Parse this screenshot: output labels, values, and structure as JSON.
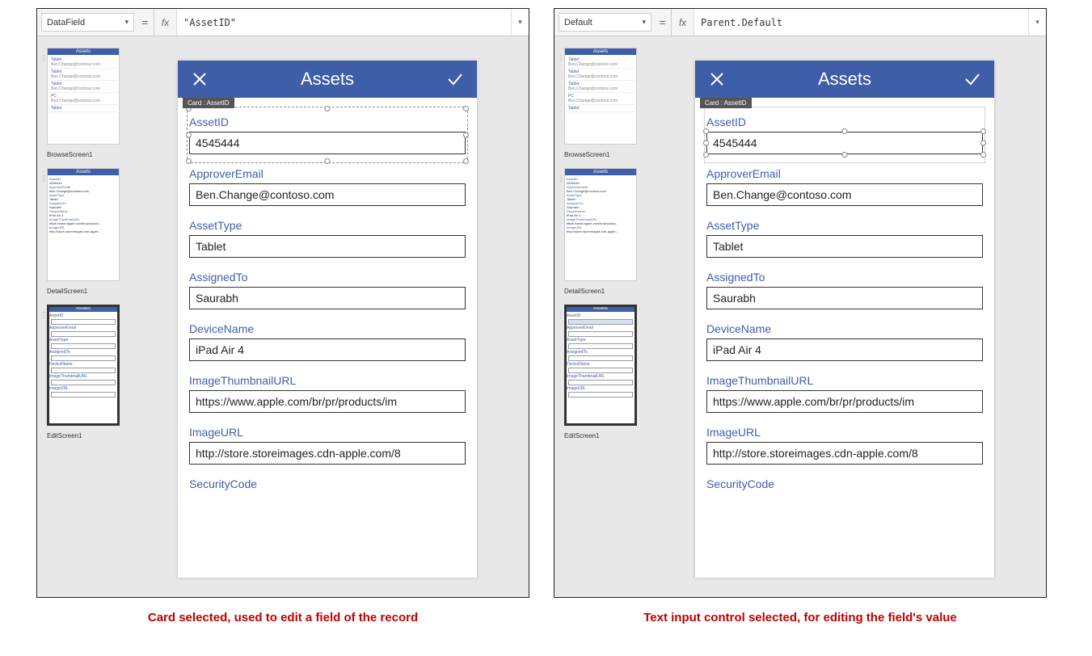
{
  "left": {
    "property": "DataField",
    "formula": "\"AssetID\"",
    "caption": "Card selected, used to edit a field of the record",
    "cardBadge": "Card : AssetID"
  },
  "right": {
    "property": "Default",
    "formula": "Parent.Default",
    "caption": "Text input control selected, for editing the field's value",
    "cardBadge": "Card : AssetID"
  },
  "thumbs": {
    "browse": "BrowseScreen1",
    "detail": "DetailScreen1",
    "edit": "EditScreen1",
    "headerText": "Assets"
  },
  "phone": {
    "title": "Assets"
  },
  "fields": [
    {
      "label": "AssetID",
      "value": "4545444"
    },
    {
      "label": "ApproverEmail",
      "value": "Ben.Change@contoso.com"
    },
    {
      "label": "AssetType",
      "value": "Tablet"
    },
    {
      "label": "AssignedTo",
      "value": "Saurabh"
    },
    {
      "label": "DeviceName",
      "value": "iPad Air 4"
    },
    {
      "label": "ImageThumbnailURL",
      "value": "https://www.apple.com/br/pr/products/im"
    },
    {
      "label": "ImageURL",
      "value": "http://store.storeimages.cdn-apple.com/8"
    },
    {
      "label": "SecurityCode",
      "value": ""
    }
  ]
}
